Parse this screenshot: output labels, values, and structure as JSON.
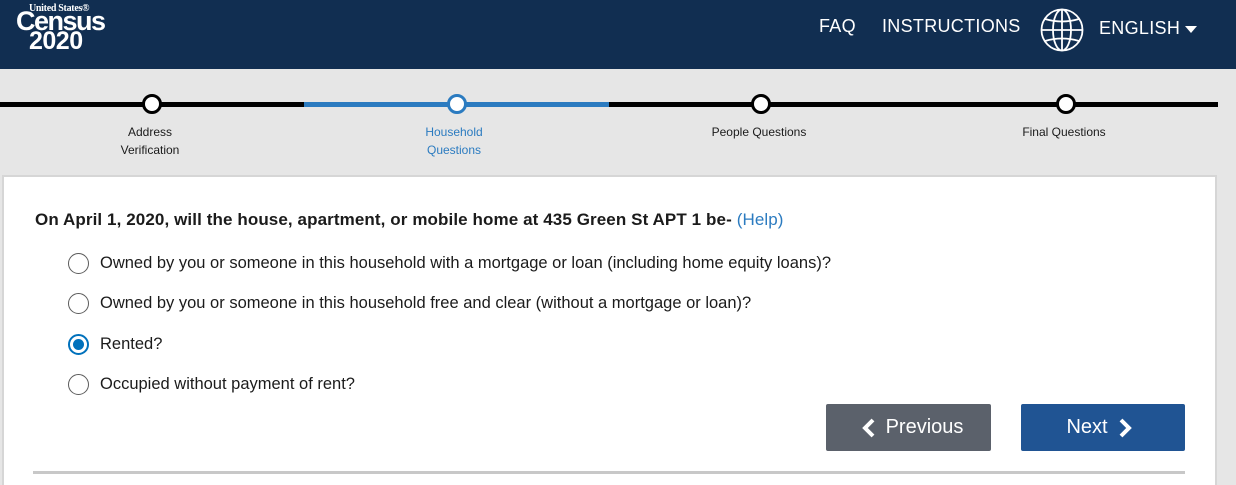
{
  "header": {
    "logo": {
      "top_text": "United States®",
      "brand": "Census",
      "year": "2020"
    },
    "nav": {
      "faq": "FAQ",
      "instructions": "INSTRUCTIONS"
    },
    "language": {
      "label": "ENGLISH",
      "icon": "globe-icon"
    },
    "colors": {
      "background": "#112e51",
      "text": "#ffffff"
    }
  },
  "progress": {
    "steps": [
      {
        "label_line1": "Address",
        "label_line2": "Verification",
        "active": false
      },
      {
        "label_line1": "Household",
        "label_line2": "Questions",
        "active": true
      },
      {
        "label_line1": "People Questions",
        "label_line2": "",
        "active": false
      },
      {
        "label_line1": "Final Questions",
        "label_line2": "",
        "active": false
      }
    ],
    "active_color": "#2b7bc0"
  },
  "question": {
    "text": "On April 1, 2020, will the house, apartment, or mobile home at 435 Green St APT 1 be-",
    "help": "(Help)",
    "options": [
      {
        "label": "Owned by you or someone in this household with a mortgage or loan (including home equity loans)?",
        "checked": false
      },
      {
        "label": "Owned by you or someone in this household free and clear (without a mortgage or loan)?",
        "checked": false
      },
      {
        "label": "Rented?",
        "checked": true
      },
      {
        "label": "Occupied without payment of rent?",
        "checked": false
      }
    ]
  },
  "buttons": {
    "previous": "Previous",
    "next": "Next",
    "previous_color": "#5b616b",
    "next_color": "#205493"
  }
}
